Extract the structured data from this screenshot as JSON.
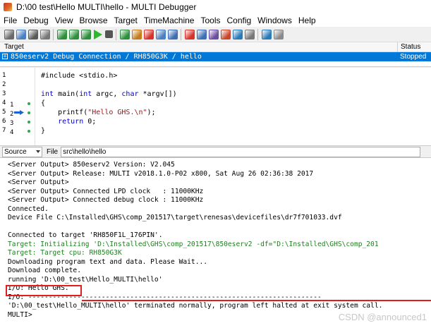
{
  "window": {
    "title": "D:\\00 test\\Hello MULTI\\hello - MULTI Debugger"
  },
  "menu": [
    "File",
    "Debug",
    "View",
    "Browse",
    "Target",
    "TimeMachine",
    "Tools",
    "Config",
    "Windows",
    "Help"
  ],
  "toolbar_icons": [
    "back-icon",
    "stop-icon",
    "grid-icon",
    "flag-icon",
    "sep",
    "step-into-icon",
    "step-over-icon",
    "step-out-icon",
    "run-icon",
    "halt-icon",
    "sep",
    "restart-icon",
    "download-icon",
    "breakpoint-icon",
    "target-icon",
    "connect-icon",
    "sep",
    "memory-icon",
    "register-icon",
    "watch-icon",
    "trace-icon",
    "profile-icon",
    "osa-icon",
    "sep",
    "refresh-icon",
    "settings-icon"
  ],
  "target_pane": {
    "column_target": "Target",
    "column_status": "Status",
    "row_name": "850eserv2 Debug Connection / RH850G3K / hello",
    "row_status": "Stopped"
  },
  "source": {
    "lines": [
      {
        "num": "1",
        "bp": "",
        "arrow": false,
        "dot": false,
        "tokens": [
          [
            "#include <stdio.h>",
            "plain"
          ]
        ]
      },
      {
        "num": "2",
        "bp": "",
        "arrow": false,
        "dot": false,
        "tokens": [
          [
            "",
            "plain"
          ]
        ]
      },
      {
        "num": "3",
        "bp": "",
        "arrow": false,
        "dot": false,
        "tokens": [
          [
            "int",
            "kw"
          ],
          [
            " main(",
            "plain"
          ],
          [
            "int",
            "kw"
          ],
          [
            " argc, ",
            "plain"
          ],
          [
            "char",
            "kw"
          ],
          [
            " *argv[])",
            "plain"
          ]
        ]
      },
      {
        "num": "4",
        "bp": "1",
        "arrow": false,
        "dot": true,
        "tokens": [
          [
            "{",
            "plain"
          ]
        ]
      },
      {
        "num": "5",
        "bp": "2",
        "arrow": true,
        "dot": true,
        "tokens": [
          [
            "    printf(",
            "plain"
          ],
          [
            "\"Hello GHS.\\n\"",
            "str"
          ],
          [
            ");",
            "plain"
          ]
        ]
      },
      {
        "num": "6",
        "bp": "3",
        "arrow": false,
        "dot": true,
        "tokens": [
          [
            "    ",
            "plain"
          ],
          [
            "return",
            "kw"
          ],
          [
            " 0;",
            "plain"
          ]
        ]
      },
      {
        "num": "7",
        "bp": "4",
        "arrow": false,
        "dot": true,
        "tokens": [
          [
            "}",
            "plain"
          ]
        ]
      }
    ]
  },
  "source_bar": {
    "mode": "Source",
    "file_label": "File",
    "path": "src\\hello\\hello"
  },
  "console": [
    {
      "text": "<Server Output> 850eserv2 Version: V2.045",
      "color": "black"
    },
    {
      "text": "<Server Output> Release: MULTI v2018.1.0-P02 x800, Sat Aug 26 02:36:38 2017",
      "color": "black"
    },
    {
      "text": "<Server Output>",
      "color": "black"
    },
    {
      "text": "<Server Output> Connected LPD clock   : 11000KHz",
      "color": "black"
    },
    {
      "text": "<Server Output> Connected debug clock : 11000KHz",
      "color": "black"
    },
    {
      "text": "Connected.",
      "color": "black"
    },
    {
      "text": "Device File C:\\Installed\\GHS\\comp_201517\\target\\renesas\\devicefiles\\dr7f701033.dvf",
      "color": "black"
    },
    {
      "text": "",
      "color": "black"
    },
    {
      "text": "Connected to target 'RH850F1L_176PIN'.",
      "color": "black"
    },
    {
      "text": "Target: Initializing 'D:\\Installed\\GHS\\comp_201517\\850eserv2 -df=\"D:\\Installed\\GHS\\comp_201",
      "color": "green"
    },
    {
      "text": "Target: Target cpu: RH850G3K",
      "color": "green"
    },
    {
      "text": "Downloading program text and data. Please Wait...",
      "color": "black"
    },
    {
      "text": "Download complete.",
      "color": "black"
    },
    {
      "text": "running 'D:\\00_test\\Hello_MULTI\\hello'",
      "color": "black"
    },
    {
      "text": "I/O: Hello GHS.",
      "color": "black"
    },
    {
      "text": "I/O: ------------------------------------------------------------------------",
      "color": "black"
    },
    {
      "text": "'D:\\00_test\\Hello_MULTI\\hello' terminated normally, program left halted at exit system call.",
      "color": "black"
    },
    {
      "text": "MULTI>",
      "color": "black"
    }
  ],
  "watermark": "CSDN @announced1",
  "colors": {
    "selection": "#0078d7",
    "keyword": "#0000c8",
    "string": "#a31515",
    "green_output": "#1e7f1e",
    "highlight": "#e11d1d"
  }
}
